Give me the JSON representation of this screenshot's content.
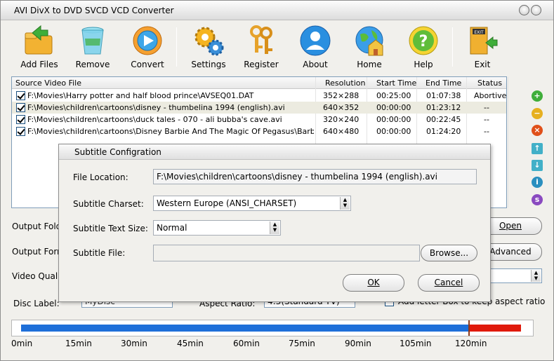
{
  "window": {
    "title": "AVI DivX to DVD SVCD VCD Converter"
  },
  "toolbar": {
    "add_files": "Add Files",
    "remove": "Remove",
    "convert": "Convert",
    "settings": "Settings",
    "register": "Register",
    "about": "About",
    "home": "Home",
    "help": "Help",
    "exit": "Exit"
  },
  "file_list": {
    "columns": [
      "Source Video File",
      "Resolution",
      "Start Time",
      "End Time",
      "Status"
    ],
    "rows": [
      {
        "file": "F:\\Movies\\Harry potter and half blood prince\\AVSEQ01.DAT",
        "resolution": "352×288",
        "start": "00:25:00",
        "end": "01:07:38",
        "status": "Abortive"
      },
      {
        "file": "F:\\Movies\\children\\cartoons\\disney - thumbelina 1994 (english).avi",
        "resolution": "640×352",
        "start": "00:00:00",
        "end": "01:23:12",
        "status": "--"
      },
      {
        "file": "F:\\Movies\\children\\cartoons\\duck tales - 070 - ali bubba's cave.avi",
        "resolution": "320×240",
        "start": "00:00:00",
        "end": "00:22:45",
        "status": "--"
      },
      {
        "file": "F:\\Movies\\children\\cartoons\\Disney Barbie And The Magic Of Pegasus\\Barbie And...",
        "resolution": "640×480",
        "start": "00:00:00",
        "end": "01:24:20",
        "status": "--"
      }
    ]
  },
  "main": {
    "output_folder_label": "Output Fold",
    "output_format_label": "Output Forn",
    "video_quality_label": "Video Qualit",
    "disc_label_label": "Disc Label:",
    "disc_label_value": "MyDisc",
    "aspect_ratio_label": "Aspect Ratio:",
    "aspect_ratio_value": "4:3(Standard TV)",
    "letterbox_label": "Add letter Box to keep aspect ratio",
    "open_button": "Open",
    "advanced_button": "Advanced"
  },
  "timeline": {
    "ticks": [
      "0min",
      "15min",
      "30min",
      "45min",
      "60min",
      "75min",
      "90min",
      "105min",
      "120min"
    ],
    "total_minutes": 134,
    "used_minutes": 120
  },
  "dialog": {
    "title": "Subtitle Configration",
    "file_location_label": "File Location:",
    "file_location_value": "F:\\Movies\\children\\cartoons\\disney - thumbelina 1994 (english).avi",
    "charset_label": "Subtitle Charset:",
    "charset_value": "Western Europe (ANSI_CHARSET)",
    "text_size_label": "Subtitle Text Size:",
    "text_size_value": "Normal",
    "subtitle_file_label": "Subtitle File:",
    "subtitle_file_value": "",
    "browse_button": "Browse...",
    "ok_button": "OK",
    "cancel_button": "Cancel"
  },
  "colors": {
    "progress_used": "#1e6fd9",
    "progress_over": "#e01a0c"
  }
}
